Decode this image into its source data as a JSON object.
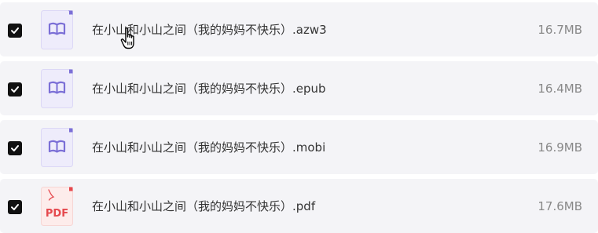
{
  "files": [
    {
      "name": "在小山和小山之间（我的妈妈不快乐）.azw3",
      "size": "16.7MB",
      "selected": true,
      "icon": "book-icon"
    },
    {
      "name": "在小山和小山之间（我的妈妈不快乐）.epub",
      "size": "16.4MB",
      "selected": true,
      "icon": "book-icon"
    },
    {
      "name": "在小山和小山之间（我的妈妈不快乐）.mobi",
      "size": "16.9MB",
      "selected": true,
      "icon": "book-icon"
    },
    {
      "name": "在小山和小山之间（我的妈妈不快乐）.pdf",
      "size": "17.6MB",
      "selected": true,
      "icon": "pdf-icon",
      "icon_text": "PDF"
    }
  ],
  "colors": {
    "row_background": "#f4f4f7",
    "checkbox": "#111111",
    "book_icon_accent": "#7b6fd6",
    "book_icon_bg": "#eeecfb",
    "pdf_icon_accent": "#e5484d",
    "pdf_icon_bg": "#fdeceb"
  }
}
